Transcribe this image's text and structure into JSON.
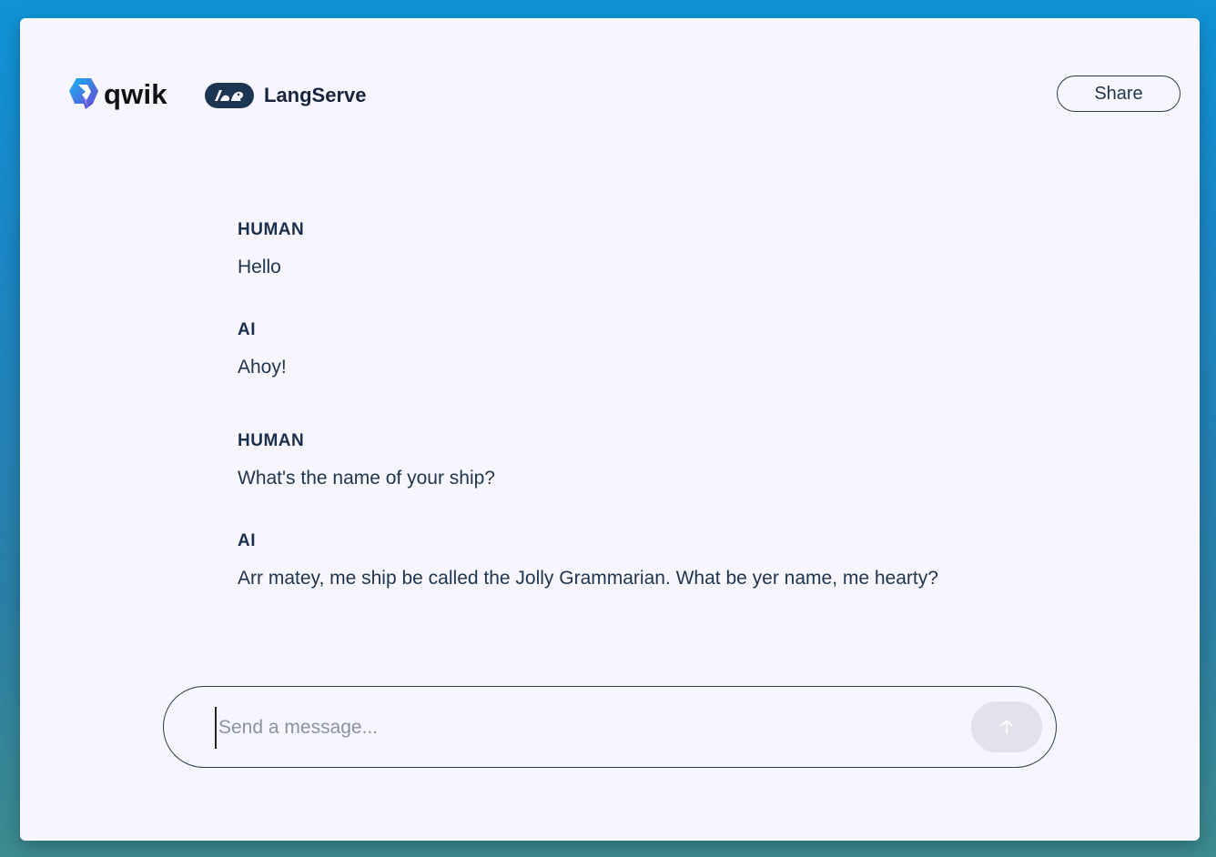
{
  "header": {
    "brand_qwik": "qwik",
    "brand_langserve": "LangServe",
    "share_label": "Share"
  },
  "messages": [
    {
      "role": "HUMAN",
      "text": "Hello"
    },
    {
      "role": "AI",
      "text": "Ahoy!"
    },
    {
      "role": "HUMAN",
      "text": "What's the name of your ship?"
    },
    {
      "role": "AI",
      "text": "Arr matey, me ship be called the Jolly Grammarian. What be yer name, me hearty?"
    }
  ],
  "composer": {
    "placeholder": "Send a message...",
    "value": "",
    "send_icon": "arrow-up-icon"
  },
  "colors": {
    "background": "#f7f5fd",
    "text": "#1e3550",
    "border": "#2b3d55",
    "send_button_bg": "#e2e2ea"
  }
}
